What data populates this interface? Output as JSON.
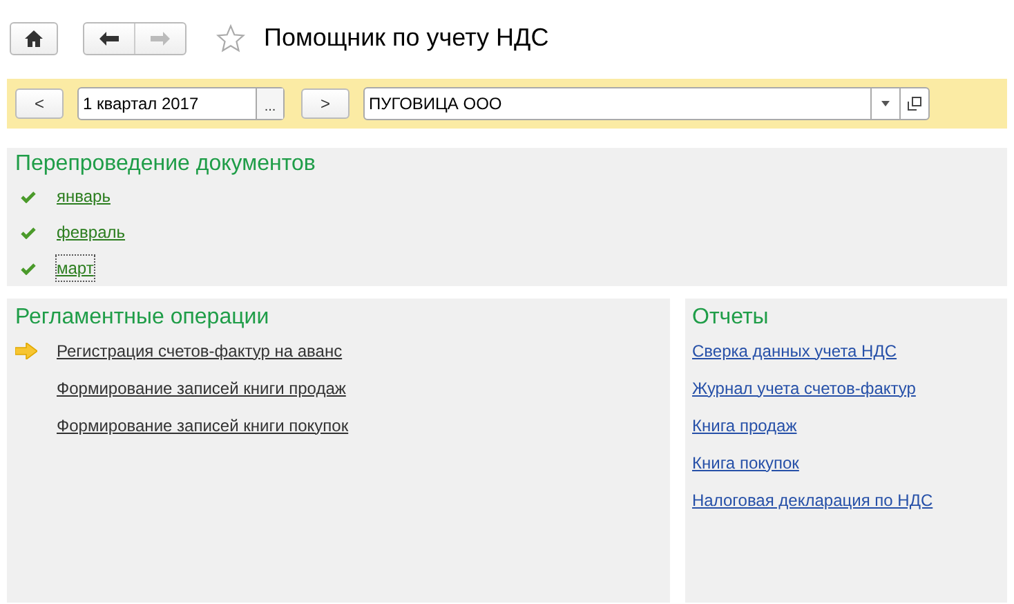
{
  "window": {
    "title": "Помощник по учету НДС",
    "favorite": false
  },
  "toolbar": {
    "prev": "<",
    "period": "1 квартал 2017",
    "period_select": "...",
    "next": ">",
    "organization": "ПУГОВИЦА ООО"
  },
  "reposting": {
    "title": "Перепроведение документов",
    "months": [
      {
        "label": "январь",
        "checked": true,
        "focused": false
      },
      {
        "label": "февраль",
        "checked": true,
        "focused": false
      },
      {
        "label": "март",
        "checked": true,
        "focused": true
      }
    ]
  },
  "operations": {
    "title": "Регламентные операции",
    "items": [
      {
        "label": "Регистрация счетов-фактур на аванс",
        "current": true
      },
      {
        "label": "Формирование записей книги продаж",
        "current": false
      },
      {
        "label": "Формирование записей книги покупок",
        "current": false
      }
    ]
  },
  "reports": {
    "title": "Отчеты",
    "items": [
      "Сверка данных учета НДС",
      "Журнал учета счетов-фактур",
      "Книга продаж",
      "Книга покупок",
      "Налоговая декларация по НДС"
    ]
  }
}
